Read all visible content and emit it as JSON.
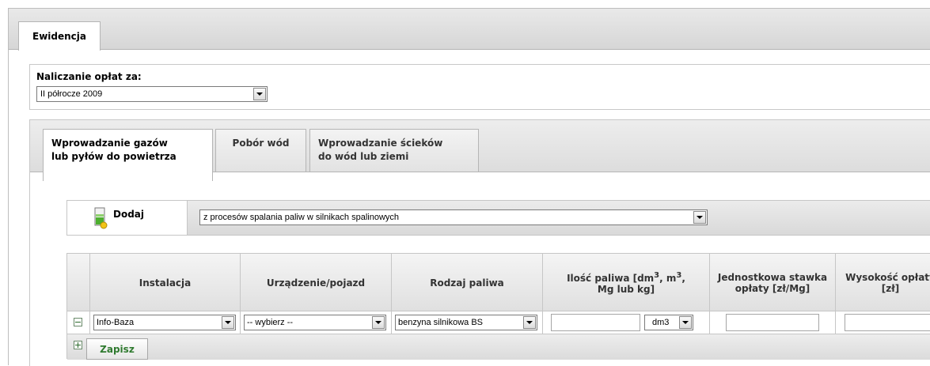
{
  "tabs_top": {
    "ewidencja": "Ewidencja"
  },
  "period": {
    "label": "Naliczanie opłat za:",
    "selected": "II półrocze 2009"
  },
  "inner_tabs": [
    {
      "line1": "Wprowadzanie gazów",
      "line2": "lub pyłów do powietrza"
    },
    {
      "line1": "Pobór wód",
      "line2": ""
    },
    {
      "line1": "Wprowadzanie ścieków",
      "line2": "do wód lub ziemi"
    }
  ],
  "toolbar": {
    "add_label": "Dodaj",
    "category_selected": "z procesów spalania paliw w silnikach spalinowych"
  },
  "table": {
    "headers": {
      "instalacja": "Instalacja",
      "urzadzenie": "Urządzenie/pojazd",
      "rodzaj": "Rodzaj paliwa",
      "ilosc_a": "Ilość paliwa [dm",
      "ilosc_sup1": "3",
      "ilosc_b": ", m",
      "ilosc_sup2": "3",
      "ilosc_c": ",",
      "ilosc_line2": "Mg lub kg]",
      "stawka": "Jednostkowa stawka opłaty [zł/Mg]",
      "wysokosc": "Wysokość opłaty [zł]"
    },
    "row": {
      "instalacja": "Info-Baza",
      "urzadzenie": "-- wybierz --",
      "rodzaj": "benzyna silnikowa BS",
      "ilosc_value": "",
      "unit": "dm3",
      "stawka_value": "",
      "wysokosc_value": ""
    }
  },
  "footer": {
    "save_label": "Zapisz"
  }
}
